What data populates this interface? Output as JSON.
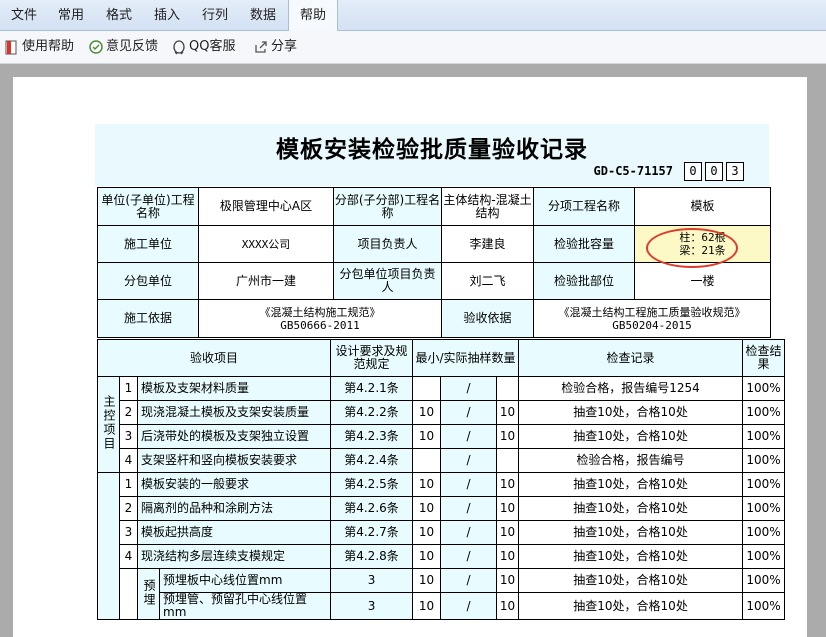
{
  "menu": {
    "items": [
      {
        "label": "文件"
      },
      {
        "label": "常用"
      },
      {
        "label": "格式"
      },
      {
        "label": "插入"
      },
      {
        "label": "行列"
      },
      {
        "label": "数据"
      },
      {
        "label": "帮助",
        "active": true
      }
    ]
  },
  "toolbar": {
    "help": {
      "label": "使用帮助",
      "icon": "book-icon"
    },
    "feedback": {
      "label": "意见反馈",
      "icon": "feedback-icon"
    },
    "qq": {
      "label": "QQ客服",
      "icon": "qq-icon"
    },
    "share": {
      "label": "分享",
      "icon": "share-icon"
    }
  },
  "form": {
    "title": "模板安装检验批质量验收记录",
    "code": "GD-C5-71157",
    "digits": [
      "0",
      "0",
      "3"
    ],
    "info": {
      "unit_label": "单位(子单位)工程名称",
      "unit_value": "极限管理中心A区",
      "sub_label": "分部(子分部)工程名称",
      "sub_value": "主体结构-混凝土结构",
      "item_label": "分项工程名称",
      "item_value": "模板",
      "contractor_label": "施工单位",
      "contractor_value": "XXXX公司",
      "pm_label": "项目负责人",
      "pm_value": "李建良",
      "capacity_label": "检验批容量",
      "capacity_value_1": "柱：62根",
      "capacity_value_2": "梁：21条",
      "subcon_label": "分包单位",
      "subcon_value": "广州市一建",
      "subcon_pm_label": "分包单位项目负责人",
      "subcon_pm_value": "刘二飞",
      "part_label": "检验批部位",
      "part_value": "一楼",
      "basis_label": "施工依据",
      "basis_value_1": "《混凝土结构施工规范》",
      "basis_value_2": "GB50666-2011",
      "accept_basis_label": "验收依据",
      "accept_basis_value_1": "《混凝土结构工程施工质量验收规范》",
      "accept_basis_value_2": "GB50204-2015"
    },
    "header": {
      "item": "验收项目",
      "design": "设计要求及规范规定",
      "sample": "最小/实际抽样数量",
      "record": "检查记录",
      "result": "检查结果"
    },
    "main_group": "主控项目",
    "main_rows": [
      {
        "no": "1",
        "name": "模板及支架材料质量",
        "clause": "第4.2.1条",
        "min": "",
        "slash": "/",
        "actual": "",
        "record": "检验合格，报告编号1254",
        "result": "100%"
      },
      {
        "no": "2",
        "name": "现浇混凝土模板及支架安装质量",
        "clause": "第4.2.2条",
        "min": "10",
        "slash": "/",
        "actual": "10",
        "record": "抽查10处，合格10处",
        "result": "100%"
      },
      {
        "no": "3",
        "name": "后浇带处的模板及支架独立设置",
        "clause": "第4.2.3条",
        "min": "10",
        "slash": "/",
        "actual": "10",
        "record": "抽查10处，合格10处",
        "result": "100%"
      },
      {
        "no": "4",
        "name": "支架竖杆和竖向模板安装要求",
        "clause": "第4.2.4条",
        "min": "",
        "slash": "/",
        "actual": "",
        "record": "检验合格，报告编号",
        "result": "100%"
      }
    ],
    "general_rows": [
      {
        "no": "1",
        "name": "模板安装的一般要求",
        "clause": "第4.2.5条",
        "min": "10",
        "slash": "/",
        "actual": "10",
        "record": "抽查10处，合格10处",
        "result": "100%"
      },
      {
        "no": "2",
        "name": "隔离剂的品种和涂刷方法",
        "clause": "第4.2.6条",
        "min": "10",
        "slash": "/",
        "actual": "10",
        "record": "抽查10处，合格10处",
        "result": "100%"
      },
      {
        "no": "3",
        "name": "模板起拱高度",
        "clause": "第4.2.7条",
        "min": "10",
        "slash": "/",
        "actual": "10",
        "record": "抽查10处，合格10处",
        "result": "100%"
      },
      {
        "no": "4",
        "name": "现浇结构多层连续支模规定",
        "clause": "第4.2.8条",
        "min": "10",
        "slash": "/",
        "actual": "10",
        "record": "抽查10处，合格10处",
        "result": "100%"
      }
    ],
    "embed_group": "预埋",
    "embed_rows": [
      {
        "name": "预埋板中心线位置mm",
        "clause": "3",
        "min": "10",
        "slash": "/",
        "actual": "10",
        "record": "抽查10处，合格10处",
        "result": "100%"
      },
      {
        "name": "预埋管、预留孔中心线位置mm",
        "clause": "3",
        "min": "10",
        "slash": "/",
        "actual": "10",
        "record": "抽查10处，合格10处",
        "result": "100%"
      }
    ]
  }
}
